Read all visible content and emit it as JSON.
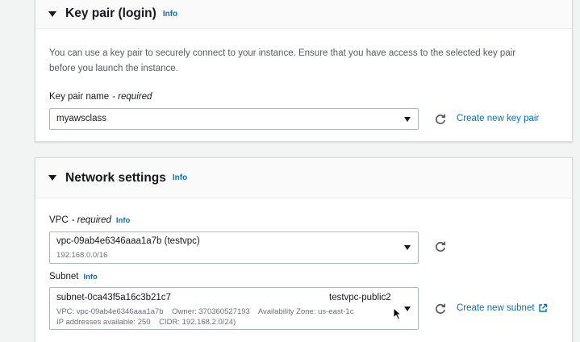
{
  "keypair": {
    "title": "Key pair (login)",
    "info": "Info",
    "description_line1": "You can use a key pair to securely connect to your instance. Ensure that you have access to the selected key pair",
    "description_line2": "before you launch the instance.",
    "field_label": "Key pair name",
    "required_text": "- required",
    "selected_value": "myawsclass",
    "create_link": "Create new key pair"
  },
  "network": {
    "title": "Network settings",
    "info": "Info",
    "vpc": {
      "label": "VPC",
      "required_text": "- required",
      "info": "Info",
      "selected_value": "vpc-09ab4e6346aaa1a7b (testvpc)",
      "cidr": "192.168.0.0/16"
    },
    "subnet": {
      "label": "Subnet",
      "info": "Info",
      "selected_value": "subnet-0ca43f5a16c3b21c7",
      "name": "testvpc-public2",
      "detail_line1": "VPC: vpc-09ab4e6346aaa1a7b    Owner: 370360527193    Availability Zone: us-east-1c",
      "detail_line2": "IP addresses available: 250    CIDR: 192.168.2.0/24)",
      "create_link": "Create new subnet"
    }
  },
  "colors": {
    "link": "#0073bb",
    "background": "#f2f3f3",
    "panel_border": "#d5dbdb",
    "input_border": "#aab7b8"
  }
}
